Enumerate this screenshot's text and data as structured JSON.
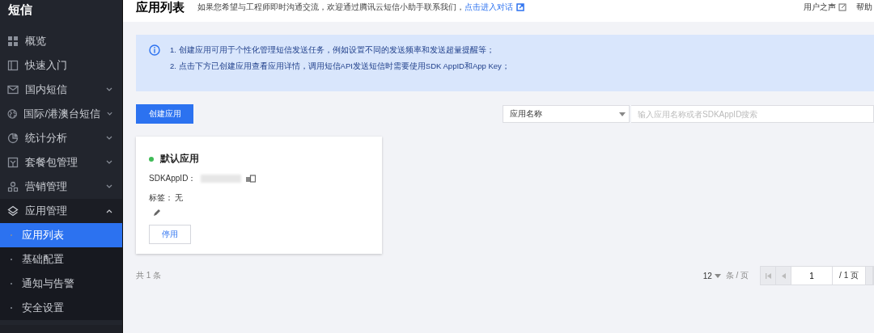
{
  "sidebar": {
    "title": "短信",
    "items": [
      {
        "label": "概览"
      },
      {
        "label": "快速入门"
      },
      {
        "label": "国内短信",
        "expanded": false
      },
      {
        "label": "国际/港澳台短信",
        "expanded": false
      },
      {
        "label": "统计分析",
        "expanded": false
      },
      {
        "label": "套餐包管理",
        "expanded": false
      },
      {
        "label": "营销管理",
        "expanded": false
      },
      {
        "label": "应用管理",
        "expanded": true,
        "children": [
          {
            "label": "应用列表",
            "selected": true
          },
          {
            "label": "基础配置",
            "selected": false
          },
          {
            "label": "通知与告警",
            "selected": false
          },
          {
            "label": "安全设置",
            "selected": false
          }
        ]
      }
    ]
  },
  "header": {
    "title": "应用列表",
    "notice": "如果您希望与工程师即时沟通交流，欢迎通过腾讯云短信小助手联系我们，",
    "link": "点击进入对话",
    "right_links": [
      "用户之声",
      "帮助"
    ]
  },
  "alert": {
    "lines": [
      "1. 创建应用可用于个性化管理短信发送任务，例如设置不同的发送频率和发送超量提醒等；",
      "2. 点击下方已创建应用查看应用详情，调用短信API发送短信时需要使用SDK AppID和App Key；"
    ]
  },
  "toolbar": {
    "create_button": "创建应用",
    "filter": "应用名称",
    "search": {
      "placeholder": "输入应用名称或者SDKAppID搜索"
    }
  },
  "apps": [
    {
      "name": "默认应用",
      "color": "#3fbb57",
      "appid_label": "SDKAppID：",
      "tag_label": "标签：",
      "tag_value": "无",
      "action": "停用"
    }
  ],
  "pagination": {
    "total": "共 1 条",
    "page_size": "12",
    "per_page": "条 / 页",
    "page": "1",
    "pages": "/ 1 页"
  }
}
